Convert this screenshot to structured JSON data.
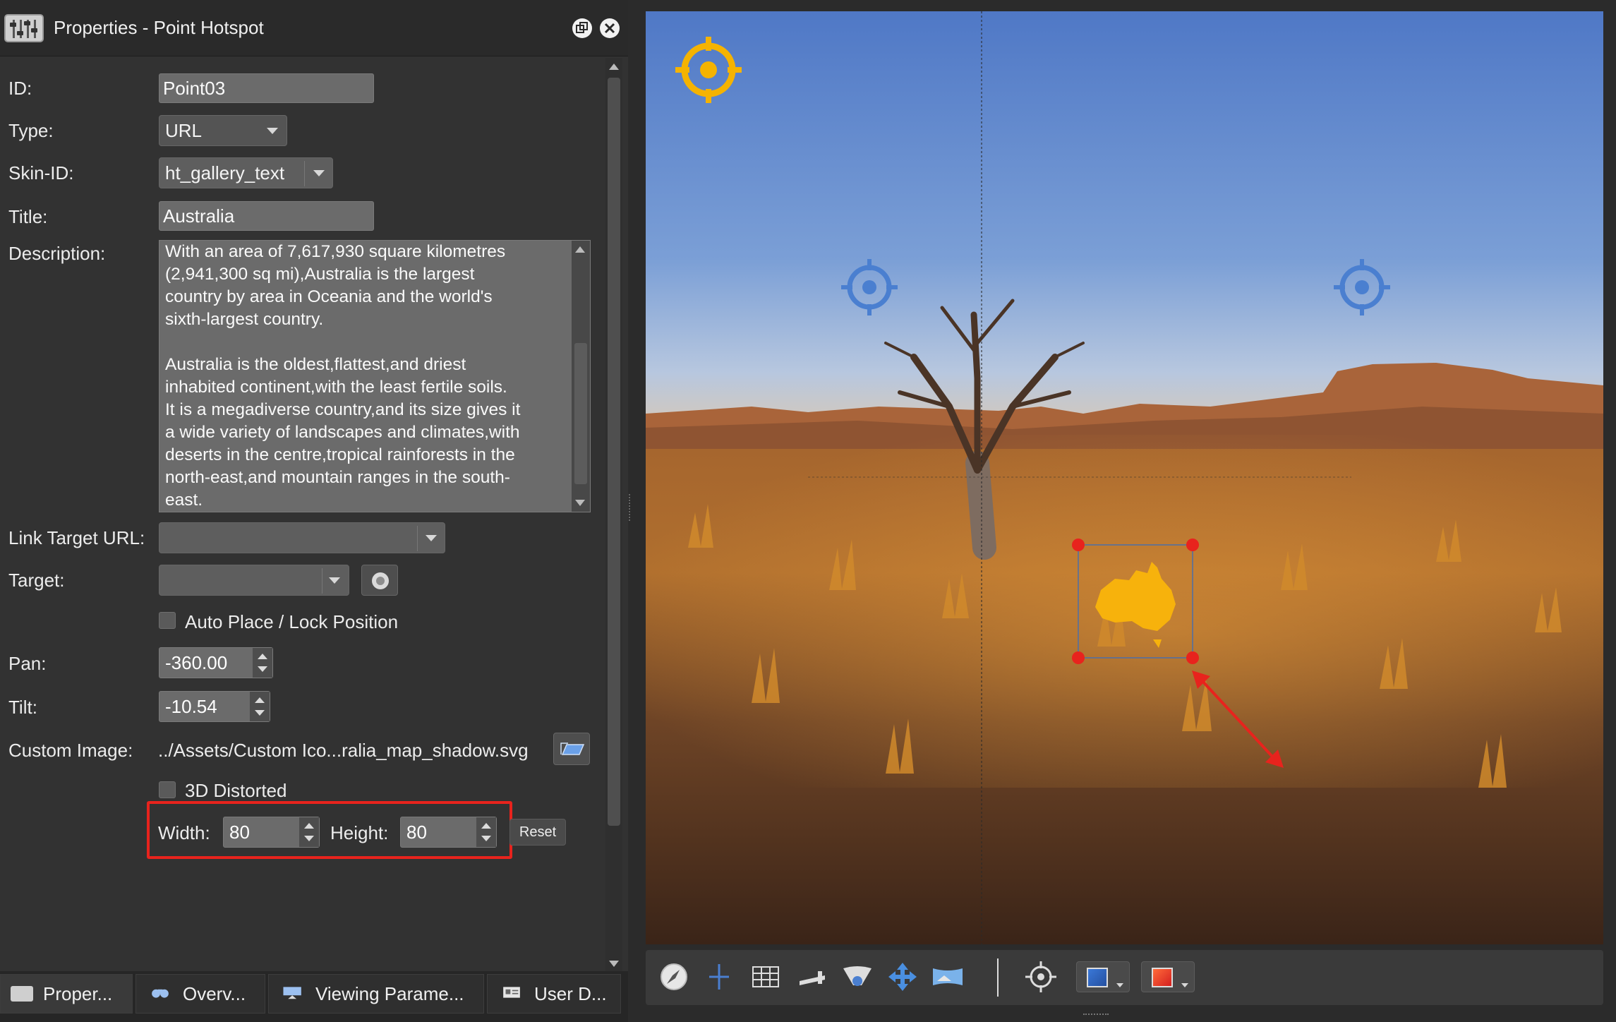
{
  "window": {
    "title": "Properties - Point Hotspot"
  },
  "form": {
    "id_label": "ID:",
    "id_value": "Point03",
    "type_label": "Type:",
    "type_value": "URL",
    "skin_label": "Skin-ID:",
    "skin_value": "ht_gallery_text",
    "title_label": "Title:",
    "title_value": "Australia",
    "description_label": "Description:",
    "description_value": "With an area of 7,617,930 square kilometres\n(2,941,300 sq mi),Australia is the largest\ncountry by area in Oceania and the world's\nsixth-largest country.\n\nAustralia is the oldest,flattest,and driest\ninhabited continent,with the least fertile soils.\nIt is a megadiverse country,and its size gives it\na wide variety of landscapes and climates,with\ndeserts in the centre,tropical rainforests in the\nnorth-east,and mountain ranges in the south-\neast.",
    "link_url_label": "Link Target URL:",
    "link_url_value": "",
    "target_label": "Target:",
    "target_value": "",
    "auto_place_label": "Auto Place / Lock Position",
    "pan_label": "Pan:",
    "pan_value": "-360.00",
    "tilt_label": "Tilt:",
    "tilt_value": "-10.54",
    "custom_image_label": "Custom Image:",
    "custom_image_value": "../Assets/Custom Ico...ralia_map_shadow.svg",
    "distorted_label": "3D Distorted",
    "width_label": "Width:",
    "width_value": "80",
    "height_label": "Height:",
    "height_value": "80",
    "reset_label": "Reset"
  },
  "tabs": [
    {
      "label": "Proper..."
    },
    {
      "label": "Overv..."
    },
    {
      "label": "Viewing Parame..."
    },
    {
      "label": "User D..."
    }
  ],
  "colors": {
    "highlight": "#e8231d",
    "hotspot_selected": "#f5b301",
    "hotspot": "#4a7fd0",
    "handle": "#e8231d"
  },
  "toolbar_icons": [
    "compass-icon",
    "crosshair-line-icon",
    "grid-icon",
    "ruler-icon",
    "viewer-eye-icon",
    "move-arrows-icon",
    "panorama-icon",
    "target-icon",
    "blue-color-icon",
    "red-color-icon"
  ]
}
